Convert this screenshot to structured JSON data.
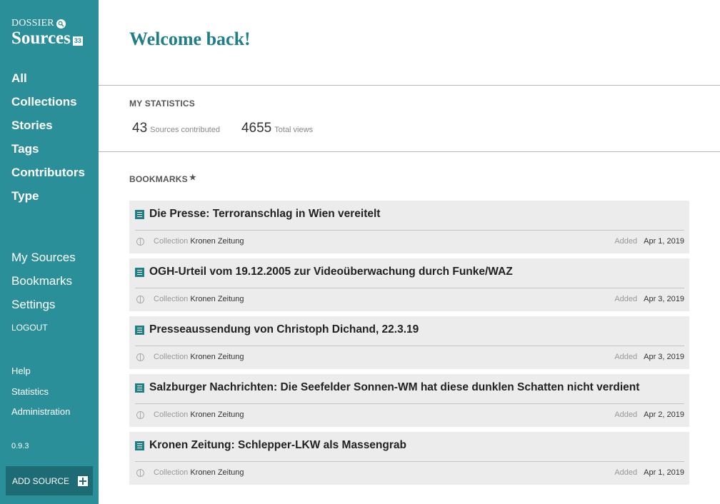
{
  "logo": {
    "top": "DOSSIER",
    "main": "Sources",
    "badge": "33"
  },
  "sidebar": {
    "main_nav": [
      {
        "label": "All"
      },
      {
        "label": "Collections"
      },
      {
        "label": "Stories"
      },
      {
        "label": "Tags"
      },
      {
        "label": "Contributors"
      },
      {
        "label": "Type"
      }
    ],
    "user_nav": [
      {
        "label": "My Sources"
      },
      {
        "label": "Bookmarks"
      },
      {
        "label": "Settings"
      }
    ],
    "logout_label": "LOGOUT",
    "extra_nav": [
      {
        "label": "Help"
      },
      {
        "label": "Statistics"
      },
      {
        "label": "Administration"
      }
    ],
    "version": "0.9.3",
    "add_source_label": "ADD SOURCE"
  },
  "main": {
    "welcome": "Welcome back!",
    "stats_heading": "MY STATISTICS",
    "stats": [
      {
        "value": "43",
        "label": "Sources contributed"
      },
      {
        "value": "4655",
        "label": "Total views"
      }
    ],
    "bookmarks_heading": "BOOKMARKS",
    "meta_labels": {
      "collection": "Collection",
      "added": "Added"
    },
    "bookmarks": [
      {
        "title": "Die Presse: Terroranschlag in Wien vereitelt",
        "collection": "Kronen Zeitung",
        "added": "Apr 1, 2019"
      },
      {
        "title": "OGH-Urteil vom 19.12.2005 zur Videoüberwachung durch Funke/WAZ",
        "collection": "Kronen Zeitung",
        "added": "Apr 3, 2019"
      },
      {
        "title": "Presseaussendung von Christoph Dichand, 22.3.19",
        "collection": "Kronen Zeitung",
        "added": "Apr 3, 2019"
      },
      {
        "title": "Salzburger Nachrichten: Die Seefelder Sonnen-WM hat diese dunklen Schatten nicht verdient",
        "collection": "Kronen Zeitung",
        "added": "Apr 2, 2019"
      },
      {
        "title": "Kronen Zeitung: Schlepper-LKW als Massengrab",
        "collection": "Kronen Zeitung",
        "added": "Apr 1, 2019"
      }
    ]
  },
  "colors": {
    "sidebar": "#2a8f99",
    "accent": "#1f7f87",
    "button": "#1d6b74"
  }
}
